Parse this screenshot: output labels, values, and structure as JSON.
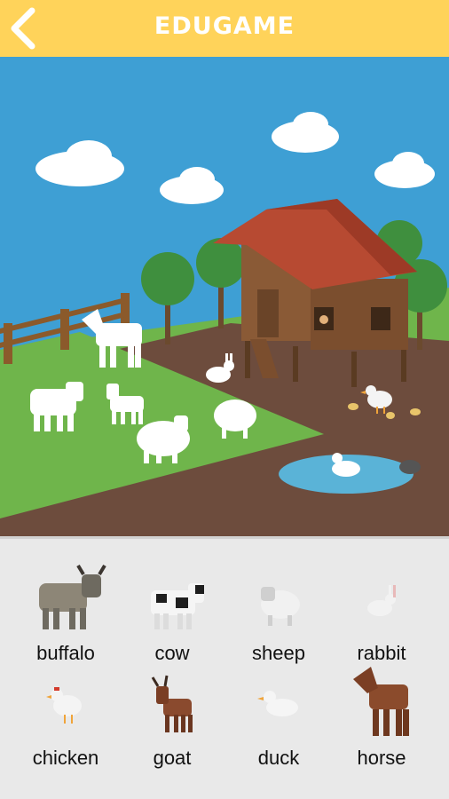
{
  "header": {
    "title": "EDUGAME",
    "back_icon": "back-arrow-icon"
  },
  "colors": {
    "header_bg": "#ffd35a",
    "sky": "#3e9fd4",
    "grass": "#6fb54b",
    "dirt": "#6d4c3d",
    "tray_bg": "#e9e9e9",
    "silhouette": "#ffffff"
  },
  "scene": {
    "silhouettes": [
      "horse",
      "buffalo",
      "goat",
      "sheep",
      "rabbit",
      "duck"
    ],
    "extra_animals": [
      "chicken",
      "chick",
      "chick",
      "chick",
      "farmer"
    ]
  },
  "animals": [
    {
      "label": "buffalo",
      "icon": "buffalo-icon"
    },
    {
      "label": "cow",
      "icon": "cow-icon"
    },
    {
      "label": "sheep",
      "icon": "sheep-icon"
    },
    {
      "label": "rabbit",
      "icon": "rabbit-icon"
    },
    {
      "label": "chicken",
      "icon": "chicken-icon"
    },
    {
      "label": "goat",
      "icon": "goat-icon"
    },
    {
      "label": "duck",
      "icon": "duck-icon"
    },
    {
      "label": "horse",
      "icon": "horse-icon"
    }
  ]
}
